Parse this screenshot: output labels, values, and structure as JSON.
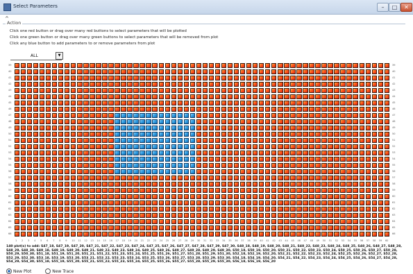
{
  "window": {
    "title": "Select Parameters",
    "minimize": "–",
    "maximize": "□",
    "close": "✕"
  },
  "panel": {
    "collapse_glyph": "^",
    "section_label": "Action"
  },
  "instructions": [
    "Click one red button or drag over many red buttons to select parameters that will be plotted",
    "Click one green button or drag over many green buttons to select parameters that will be removed from plot",
    "Click any blue button to add parameters to or remove parameters from plot"
  ],
  "filter": {
    "selected": "ALL",
    "button_glyph": "▼"
  },
  "grid": {
    "colors": {
      "red": "#ff5a1a",
      "blue": "#2f9be0"
    },
    "row_labels": [
      "39",
      "40",
      "41",
      "42",
      "43",
      "44",
      "45",
      "46",
      "47",
      "48",
      "49",
      "50",
      "51",
      "52",
      "53",
      "54",
      "55",
      "56",
      "57",
      "58",
      "59",
      "60",
      "61",
      "62",
      "63",
      "64",
      "65",
      "66"
    ],
    "col_labels": [
      "1",
      "2",
      "3",
      "4",
      "5",
      "6",
      "7",
      "8",
      "9",
      "10",
      "11",
      "12",
      "13",
      "14",
      "15",
      "16",
      "17",
      "18",
      "19",
      "20",
      "21",
      "22",
      "23",
      "24",
      "25",
      "26",
      "27",
      "28",
      "29",
      "30",
      "31",
      "32",
      "33",
      "34",
      "35",
      "36",
      "37",
      "38",
      "39",
      "40",
      "41",
      "42",
      "43",
      "44",
      "45",
      "46",
      "47",
      "48",
      "49",
      "50",
      "51",
      "52",
      "53",
      "54",
      "55",
      "56",
      "57",
      "58",
      "59",
      "60"
    ],
    "selected_rows": [
      47,
      56
    ],
    "selected_cols": [
      17,
      29
    ]
  },
  "selection_text": "140 plot(s) to add: S47_18, S47_19, S47_20, S47_21, S47_22, S47_23, S47_24, S47_25, S47_26, S47_27, S47_28, S47_29, S47_30, S48_18, S48_19, S48_20, S48_21, S48_22, S48_23, S48_24, S48_25, S48_26, S48_27, S48_28, S48_29, S48_30, S49_18, S49_19, S49_20, S49_21, S49_22, S49_23, S49_24, S49_25, S49_26, S49_27, S49_28, S49_29, S49_30, S50_18, S50_19, S50_20, S50_21, S50_22, S50_23, S50_24, S50_25, S50_26, S50_27, S50_28, S50_29, S50_30, S51_18, S51_19, S51_20, S51_21, S51_22, S51_23, S51_24, S51_25, S51_26, S51_27, S51_28, S51_29, S51_30, S52_18, S52_19, S52_20, S52_21, S52_22, S52_23, S52_24, S52_25, S52_26, S52_27, S52_28, S52_29, S52_30, S53_18, S53_19, S53_20, S53_21, S53_22, S53_23, S53_24, S53_25, S53_26, S53_27, S53_28, S53_29, S53_30, S54_18, S54_19, S54_20, S54_21, S54_22, S54_23, S54_24, S54_25, S54_26, S54_27, S54_28, S54_29, S54_30, S55_18, S55_19, S55_20, S55_21, S55_22, S55_23, S55_24, S55_25, S55_26, S55_27, S55_28, S55_29, S55_30, S56_18, S56_19, S56_20",
  "plot_mode": {
    "new_plot": "New Plot",
    "new_trace": "New Trace",
    "selected": "new_plot"
  }
}
